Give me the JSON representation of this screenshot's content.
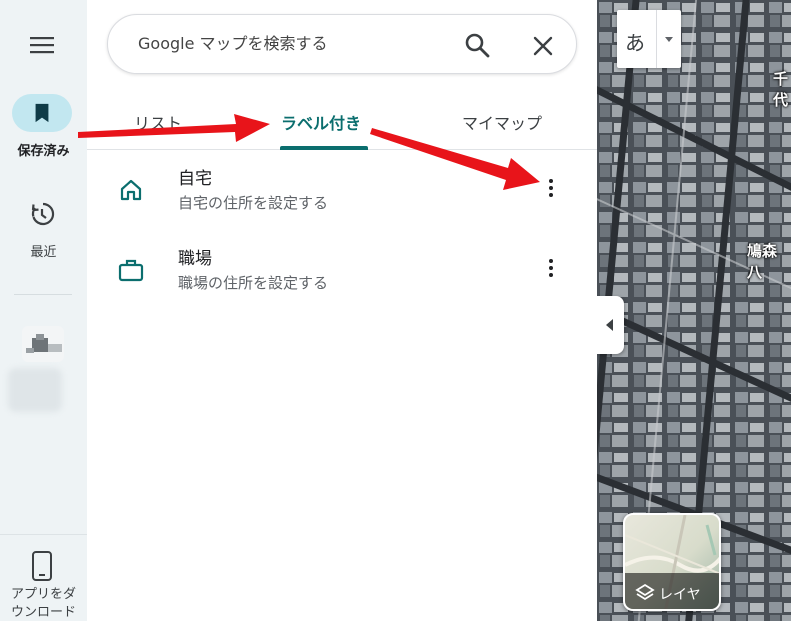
{
  "rail": {
    "saved_label": "保存済み",
    "recent_label": "最近",
    "app_label_line1": "アプリをダ",
    "app_label_line2": "ウンロード"
  },
  "search": {
    "placeholder": "Google マップを検索する"
  },
  "tabs": [
    {
      "label": "リスト"
    },
    {
      "label": "ラベル付き",
      "active": true
    },
    {
      "label": "マイマップ"
    }
  ],
  "items": [
    {
      "title": "自宅",
      "subtitle": "自宅の住所を設定する",
      "icon": "home-icon"
    },
    {
      "title": "職場",
      "subtitle": "職場の住所を設定する",
      "icon": "briefcase-icon"
    }
  ],
  "map": {
    "ime_char": "あ",
    "labels": [
      "千代",
      "鳩森八"
    ],
    "layers_label": "レイヤ"
  },
  "colors": {
    "accent": "#0b6e6e",
    "rail_bg": "#eef3f5",
    "saved_pill": "#c2e7f0",
    "annotation_arrow": "#e8141a"
  }
}
